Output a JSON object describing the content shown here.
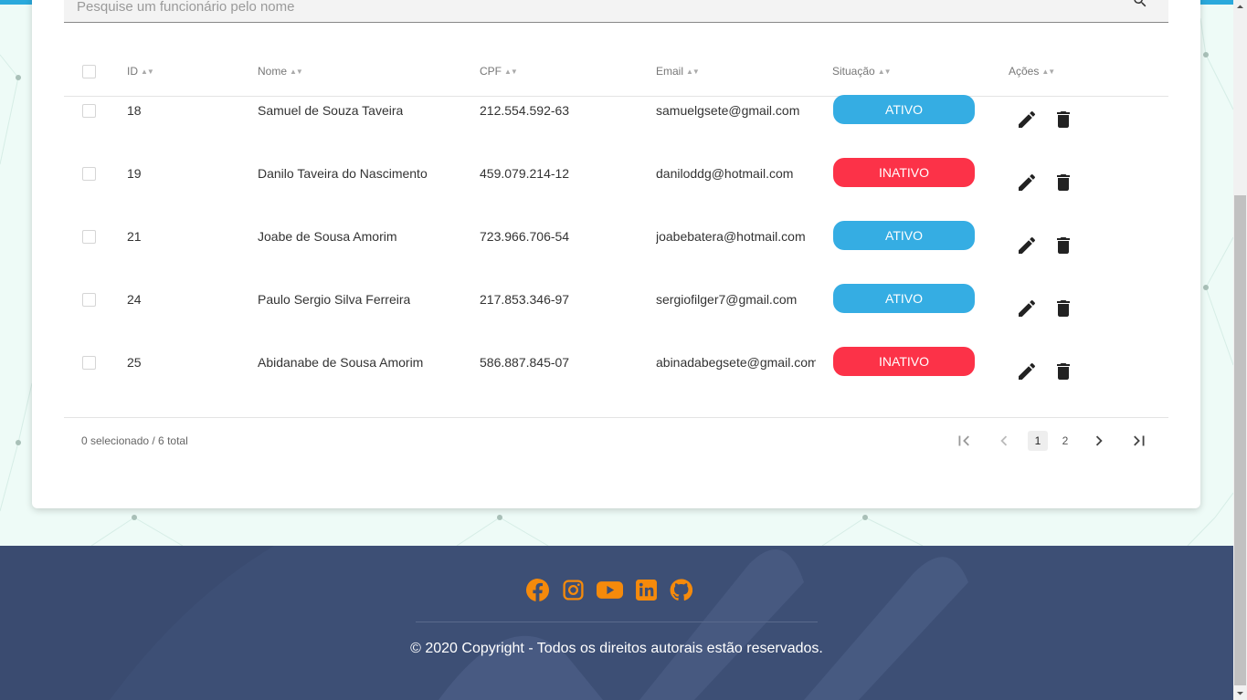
{
  "search": {
    "placeholder": "Pesquise um funcionário pelo nome"
  },
  "table": {
    "headers": {
      "id": "ID",
      "nome": "Nome",
      "cpf": "CPF",
      "email": "Email",
      "situacao": "Situação",
      "acoes": "Ações"
    },
    "rows": [
      {
        "id": "18",
        "nome": "Samuel de Souza Taveira",
        "cpf": "212.554.592-63",
        "email": "samuelgsete@gmail.com",
        "situacao": "ATIVO"
      },
      {
        "id": "19",
        "nome": "Danilo Taveira do Nascimento",
        "cpf": "459.079.214-12",
        "email": "daniloddg@hotmail.com",
        "situacao": "INATIVO"
      },
      {
        "id": "21",
        "nome": "Joabe de Sousa Amorim",
        "cpf": "723.966.706-54",
        "email": "joabebatera@hotmail.com",
        "situacao": "ATIVO"
      },
      {
        "id": "24",
        "nome": "Paulo Sergio Silva Ferreira",
        "cpf": "217.853.346-97",
        "email": "sergiofilger7@gmail.com",
        "situacao": "ATIVO"
      },
      {
        "id": "25",
        "nome": "Abidanabe de Sousa Amorim",
        "cpf": "586.887.845-07",
        "email": "abinadabegsete@gmail.com",
        "situacao": "INATIVO"
      }
    ],
    "selection_summary": "0 selecionado / 6 total"
  },
  "pagination": {
    "pages": [
      "1",
      "2"
    ],
    "current": "1"
  },
  "colors": {
    "ativo": "#35ade3",
    "inativo": "#fc3248",
    "footer_bg": "#3d4f75",
    "social_icon": "#f58a0b"
  },
  "footer": {
    "social_icons": [
      "facebook-icon",
      "instagram-icon",
      "youtube-icon",
      "linkedin-icon",
      "github-icon"
    ],
    "copyright": "© 2020 Copyright - Todos os direitos autorais estão reservados."
  }
}
